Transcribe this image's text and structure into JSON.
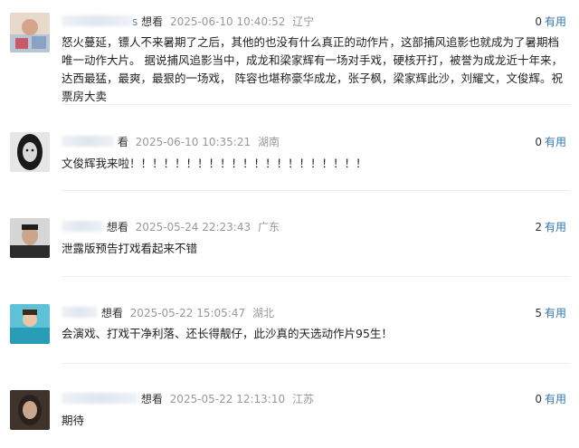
{
  "comments": [
    {
      "user_visible": "s",
      "status": "想看",
      "time": "2025-06-10 10:40:52",
      "location": "辽宁",
      "text": "怒火蔓延，镖人不来暑期了之后，其他的也没有什么真正的动作片，这部捕风追影也就成为了暑期档唯一动作大片。 据说捕风追影当中，成龙和梁家辉有一场对手戏，硬核开打，被誉为成龙近十年来，达西最猛，最爽，最狠的一场戏， 阵容也堪称豪华成龙，张子枫，梁家辉此沙，刘耀文，文俊辉。祝票房大卖",
      "useful_count": "0",
      "useful_label": "有用",
      "avatar_colors": [
        "#d9c2b0",
        "#b56a6a"
      ]
    },
    {
      "user_visible": "",
      "status": "看",
      "time": "2025-06-10 10:35:21",
      "location": "湖南",
      "text": "文俊辉我来啦！！！！！！！！！！！！！！！！！！！！！",
      "useful_count": "0",
      "useful_label": "有用",
      "avatar_colors": [
        "#222222",
        "#e8e8e8"
      ]
    },
    {
      "user_visible": "",
      "status": "想看",
      "time": "2025-05-24 22:23:43",
      "location": "广东",
      "text": "泄露版预告打戏看起来不错",
      "useful_count": "2",
      "useful_label": "有用",
      "avatar_colors": [
        "#cfcfcf",
        "#3b3b3b"
      ]
    },
    {
      "user_visible": "",
      "status": "想看",
      "time": "2025-05-22 15:05:47",
      "location": "湖北",
      "text": "会演戏、打戏干净利落、还长得靓仔，此沙真的天选动作片95生！",
      "useful_count": "5",
      "useful_label": "有用",
      "avatar_colors": [
        "#7fd3e0",
        "#2b9fb4"
      ]
    },
    {
      "user_visible": "",
      "status": "想看",
      "time": "2025-05-22 12:13:10",
      "location": "江苏",
      "text": "期待",
      "useful_count": "0",
      "useful_label": "有用",
      "avatar_colors": [
        "#4a3a30",
        "#c9a98f"
      ]
    }
  ]
}
